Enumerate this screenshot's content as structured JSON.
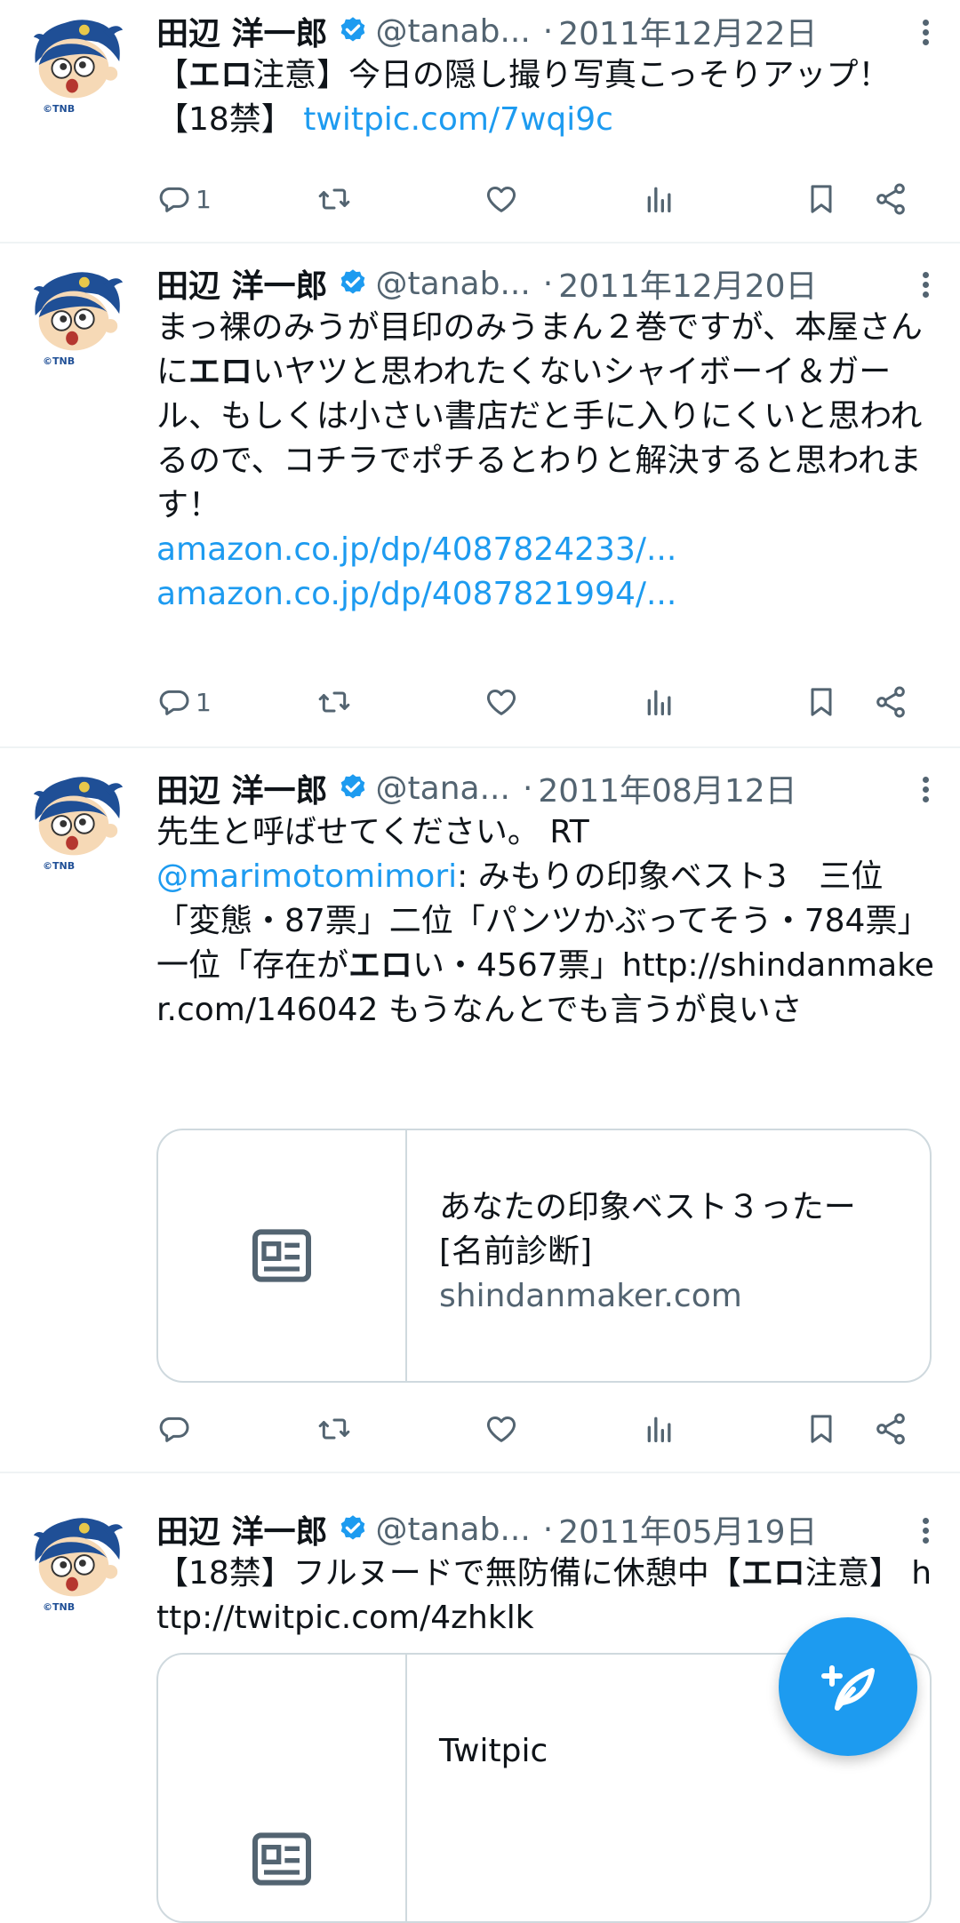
{
  "tweets": [
    {
      "name": "田辺 洋一郎",
      "handle": "@tanab...",
      "dot": "·",
      "date": "2011年12月22日",
      "body_parts": [
        {
          "text": "【",
          "style": "normal"
        },
        {
          "text": "エロ",
          "style": "bold"
        },
        {
          "text": "注意】今日の隠し撮り写真こっそりアップ！【18禁】 ",
          "style": "normal"
        },
        {
          "text": "twitpic.com/7wqi9c",
          "style": "link"
        }
      ],
      "reply_count": "1"
    },
    {
      "name": "田辺 洋一郎",
      "handle": "@tanab...",
      "dot": "·",
      "date": "2011年12月20日",
      "body_parts": [
        {
          "text": "まっ裸のみうが目印のみうまん２巻ですが、本屋さんに",
          "style": "normal"
        },
        {
          "text": "エロ",
          "style": "bold"
        },
        {
          "text": "いヤツと思われたくないシャイボーイ＆ガール、もしくは小さい書店だと手に入りにくいと思われるので、コチラでポチるとわりと解決すると思われます！\n",
          "style": "normal"
        },
        {
          "text": "amazon.co.jp/dp/4087824233/...",
          "style": "link"
        },
        {
          "text": "\n",
          "style": "normal"
        },
        {
          "text": "amazon.co.jp/dp/4087821994/...",
          "style": "link"
        }
      ],
      "reply_count": "1"
    },
    {
      "name": "田辺 洋一郎",
      "handle": "@tana...",
      "dot": "·",
      "date": "2011年08月12日",
      "body_parts": [
        {
          "text": "先生と呼ばせてください。 RT\n",
          "style": "normal"
        },
        {
          "text": "@marimotomimori",
          "style": "link"
        },
        {
          "text": ": みもりの印象ベスト3　三位「変態・87票」二位「パンツかぶってそう・784票」一位「存在が",
          "style": "normal"
        },
        {
          "text": "エロ",
          "style": "bold"
        },
        {
          "text": "い・4567票」http://shindanmaker.com/146042 もうなんとでも言うが良いさ",
          "style": "normal"
        }
      ],
      "reply_count": "",
      "card": {
        "title": "あなたの印象ベスト３ったー [名前診断]",
        "domain": "shindanmaker.com"
      }
    },
    {
      "name": "田辺 洋一郎",
      "handle": "@tanab...",
      "dot": "·",
      "date": "2011年05月19日",
      "body_parts": [
        {
          "text": "【18禁】フルヌードで無防備に休憩中【",
          "style": "normal"
        },
        {
          "text": "エロ",
          "style": "bold"
        },
        {
          "text": "注意】 http://twitpic.com/4zhklk",
          "style": "normal"
        }
      ],
      "card": {
        "title": "Twitpic",
        "domain": ""
      }
    }
  ],
  "avatar_text": "©TNB",
  "colors": {
    "accent": "#1d9bf0",
    "muted": "#536471",
    "text": "#0f1419",
    "border": "#cfd9de"
  },
  "icons": [
    "verified-badge-icon",
    "more-icon",
    "reply-icon",
    "retweet-icon",
    "like-icon",
    "views-icon",
    "bookmark-icon",
    "share-icon",
    "link-card-icon",
    "compose-icon"
  ]
}
